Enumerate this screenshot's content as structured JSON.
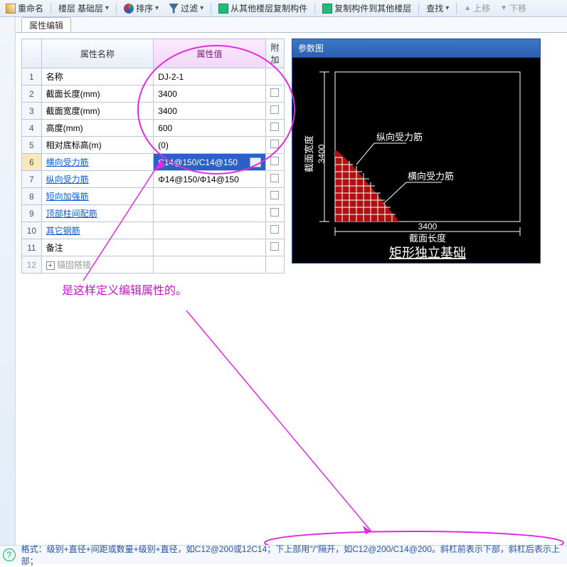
{
  "toolbar": {
    "rename": "重命名",
    "floor_label": "楼层",
    "floor_value": "基础层",
    "sort": "排序",
    "filter": "过滤",
    "copy_from": "从其他楼层复制构件",
    "copy_to": "复制构件到其他楼层",
    "find": "查找",
    "move_up": "上移",
    "move_down": "下移"
  },
  "tab": {
    "label": "属性编辑"
  },
  "prop": {
    "head_name": "属性名称",
    "head_value": "属性值",
    "head_extra": "附加",
    "rows": [
      {
        "n": "1",
        "name": "名称",
        "val": "DJ-2-1",
        "chk": false,
        "link": false
      },
      {
        "n": "2",
        "name": "截面长度(mm)",
        "val": "3400",
        "chk": true,
        "link": false
      },
      {
        "n": "3",
        "name": "截面宽度(mm)",
        "val": "3400",
        "chk": true,
        "link": false
      },
      {
        "n": "4",
        "name": "高度(mm)",
        "val": "600",
        "chk": true,
        "link": false
      },
      {
        "n": "5",
        "name": "相对底标高(m)",
        "val": "(0)",
        "chk": true,
        "link": false
      },
      {
        "n": "6",
        "name": "横向受力筋",
        "val": "C14@150/C14@150",
        "chk": true,
        "link": true,
        "sel": true
      },
      {
        "n": "7",
        "name": "纵向受力筋",
        "val": "Φ14@150/Φ14@150",
        "chk": true,
        "link": true
      },
      {
        "n": "8",
        "name": "短向加强筋",
        "val": "",
        "chk": true,
        "link": true
      },
      {
        "n": "9",
        "name": "顶部柱间配筋",
        "val": "",
        "chk": true,
        "link": true
      },
      {
        "n": "10",
        "name": "其它钢筋",
        "val": "",
        "chk": true,
        "link": true
      },
      {
        "n": "11",
        "name": "备注",
        "val": "",
        "chk": true,
        "link": false
      },
      {
        "n": "12",
        "name": "锚固搭接",
        "val": "",
        "chk": false,
        "link": false,
        "expander": true,
        "disabled": true
      }
    ]
  },
  "param": {
    "title": "参数图",
    "v_axis_label": "截面宽度",
    "v_axis_val": "3400",
    "h_axis_label": "截面长度",
    "h_axis_val": "3400",
    "tag1": "纵向受力筋",
    "tag2": "横向受力筋",
    "caption": "矩形独立基础"
  },
  "annotation": {
    "text": "是这样定义编辑属性的。"
  },
  "footer": {
    "text": "格式：级别+直径+间距或数量+级别+直径，如C12@200或12C14；下上部用\"/\"隔开，如C12@200/C14@200。斜杠前表示下部，斜杠后表示上部；"
  }
}
